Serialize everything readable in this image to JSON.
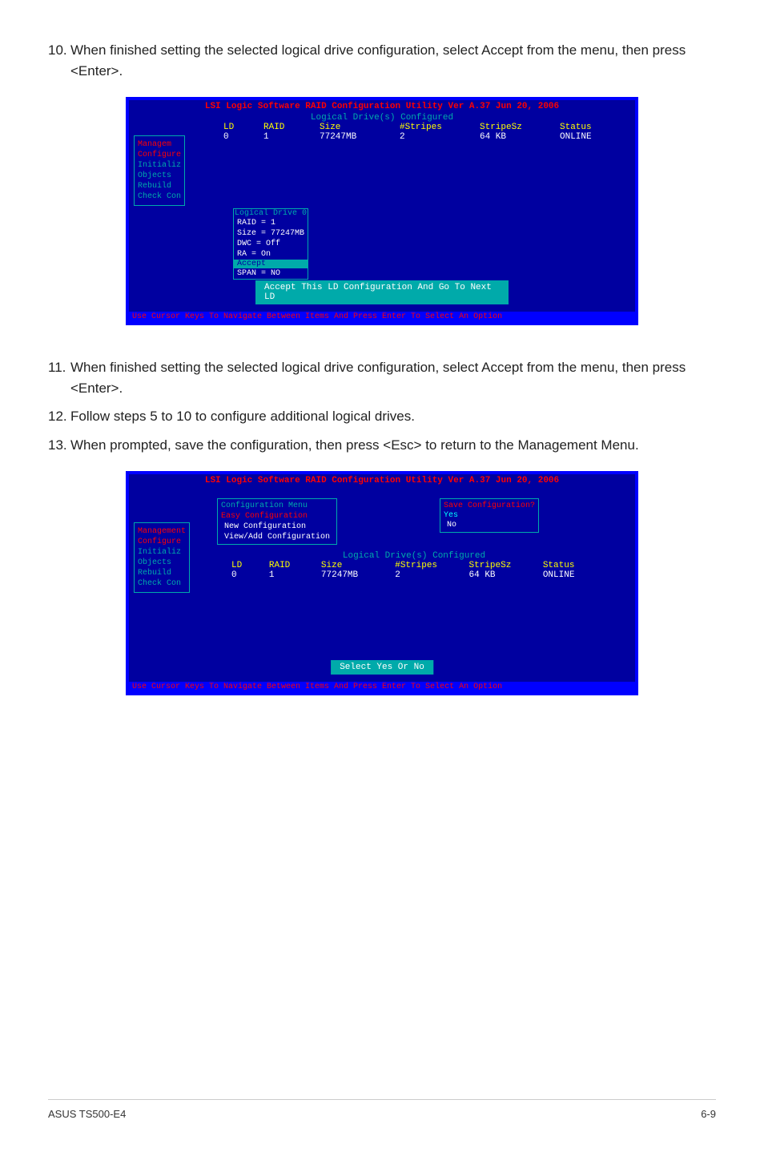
{
  "instruction10": {
    "number": "10.",
    "text": "When finished setting the selected logical drive configuration, select Accept from the menu, then press <Enter>."
  },
  "instruction11": {
    "number": "11.",
    "text": "When finished setting the selected logical drive configuration, select Accept from the menu, then press <Enter>."
  },
  "instruction12": {
    "number": "12.",
    "text": "Follow steps 5 to 10 to configure additional logical drives."
  },
  "instruction13": {
    "number": "13.",
    "text": "When prompted, save the configuration, then press <Esc> to return to the Management Menu."
  },
  "bios1": {
    "header": "LSI Logic Software RAID Configuration Utility Ver A.37 Jun 20, 2006",
    "subheader": "Logical Drive(s) Configured",
    "tableHeaders": {
      "ld": "LD",
      "raid": "RAID",
      "size": "Size",
      "stripes": "#Stripes",
      "stripesz": "StripeSz",
      "status": "Status"
    },
    "tableRow": {
      "ld": "0",
      "raid": "1",
      "size": "77247MB",
      "stripes": "2",
      "stripesz": "64  KB",
      "status": "ONLINE"
    },
    "menuItems": {
      "management": "Managem",
      "configure": "Configure",
      "initialize": "Initializ",
      "objects": "Objects",
      "rebuild": "Rebuild",
      "checkCon": "Check Con"
    },
    "logicalDrive": {
      "header": "Logical Drive 0",
      "raid": "RAID = 1",
      "size": "Size = 77247MB",
      "dwc": "DWC  = Off",
      "ra": "RA   = On",
      "accept": "Accept",
      "span": "SPAN = NO"
    },
    "actionBox": "Accept This LD Configuration And Go To Next LD",
    "footer": "Use Cursor Keys To Navigate Between Items And Press Enter To Select An Option"
  },
  "bios2": {
    "header": "LSI Logic Software RAID Configuration Utility Ver A.37 Jun 20, 2006",
    "configMenu": {
      "header": "Configuration Menu",
      "easy": "Easy Configuration",
      "new": "New Configuration",
      "view": "View/Add Configuration"
    },
    "saveConfig": {
      "header": "Save Configuration?",
      "yes": "Yes",
      "no": "No"
    },
    "menuItems": {
      "management": "Management",
      "configure": "Configure",
      "initialize": "Initializ",
      "objects": "Objects",
      "rebuild": "Rebuild",
      "checkCon": "Check Con"
    },
    "tableSubheader": "Logical Drive(s) Configured",
    "tableHeaders": {
      "ld": "LD",
      "raid": "RAID",
      "size": "Size",
      "stripes": "#Stripes",
      "stripesz": "StripeSz",
      "status": "Status"
    },
    "tableRow": {
      "ld": "0",
      "raid": "1",
      "size": "77247MB",
      "stripes": "2",
      "stripesz": "64  KB",
      "status": "ONLINE"
    },
    "selectBox": "Select Yes Or No",
    "footer": "Use Cursor Keys To Navigate Between Items And Press Enter To Select An Option"
  },
  "pageFooter": {
    "left": "ASUS TS500-E4",
    "right": "6-9"
  }
}
